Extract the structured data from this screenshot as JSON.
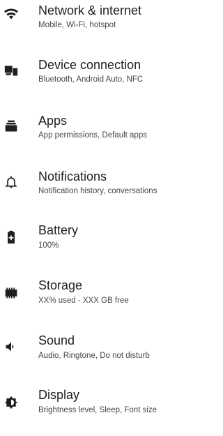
{
  "settings": {
    "items": [
      {
        "title": "Network & internet",
        "summary": "Mobile, Wi-Fi, hotspot",
        "icon": "wifi-icon"
      },
      {
        "title": "Device connection",
        "summary": "Bluetooth, Android Auto, NFC",
        "icon": "devices-icon"
      },
      {
        "title": "Apps",
        "summary": "App permissions, Default apps",
        "icon": "apps-icon"
      },
      {
        "title": "Notifications",
        "summary": "Notification history, conversations",
        "icon": "bell-icon"
      },
      {
        "title": "Battery",
        "summary": "100%",
        "icon": "battery-icon"
      },
      {
        "title": "Storage",
        "summary": "XX% used - XXX GB free",
        "icon": "storage-icon"
      },
      {
        "title": "Sound",
        "summary": "Audio, Ringtone, Do not disturb",
        "icon": "volume-icon"
      },
      {
        "title": "Display",
        "summary": "Brightness level, Sleep, Font size",
        "icon": "brightness-icon"
      }
    ]
  },
  "colors": {
    "background": "#ffffff",
    "title": "#1f1f1f",
    "summary": "#444746",
    "icon": "#1f1f1f"
  }
}
